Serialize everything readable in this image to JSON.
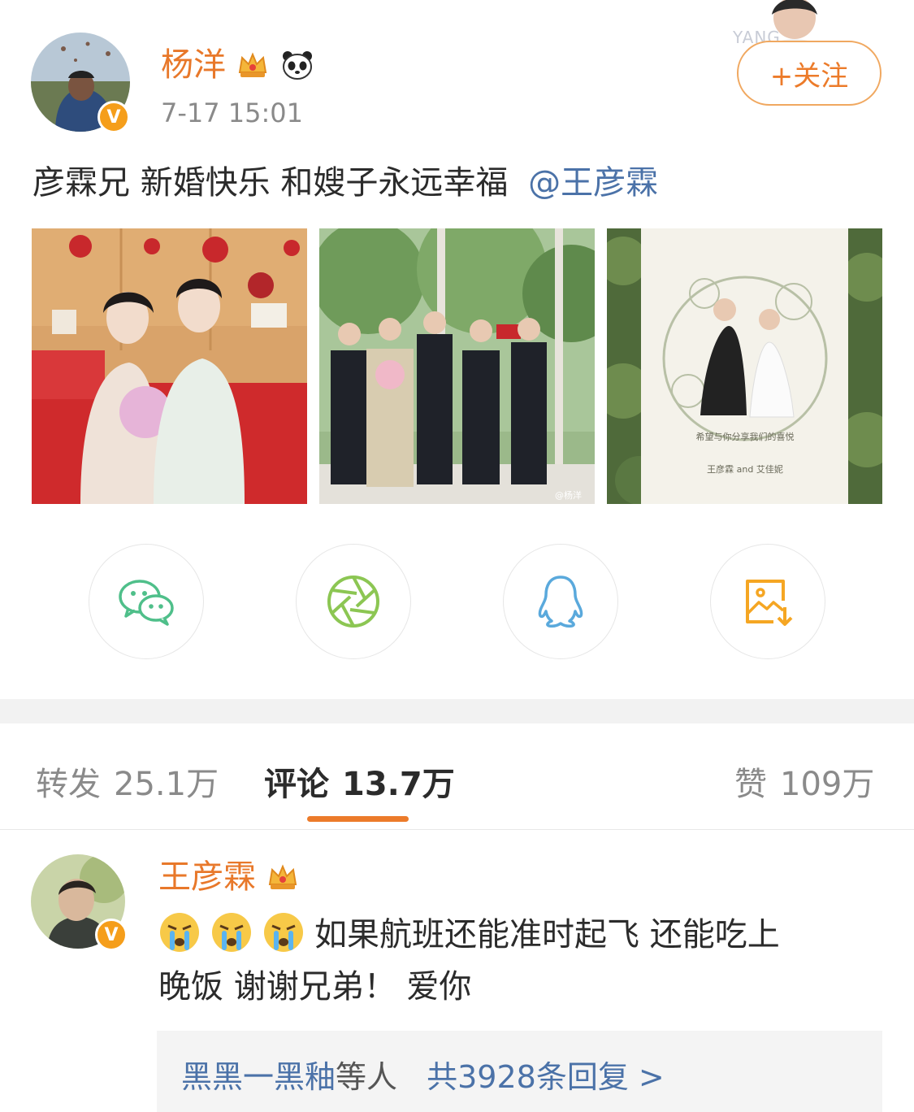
{
  "post": {
    "author": "杨洋",
    "author_badges": [
      "crown-icon",
      "panda-icon"
    ],
    "timestamp": "7-17 15:01",
    "text": "彦霖兄 新婚快乐 和嫂子永远幸福",
    "mention": "@王彦霖",
    "follow_label": "+关注",
    "corner_avatar_text": "YANG",
    "photos": [
      {
        "name": "wedding-couple-photo"
      },
      {
        "name": "groomsmen-photo",
        "watermark": "@杨洋"
      },
      {
        "name": "wedding-invitation-photo",
        "caption": "希望与你分享我们的喜悦",
        "names": "王彦霖 and 艾佳妮"
      }
    ]
  },
  "share": {
    "buttons": [
      {
        "name": "wechat-share-button",
        "icon": "wechat-icon",
        "color": "#4fbf8a"
      },
      {
        "name": "moments-share-button",
        "icon": "aperture-icon",
        "color": "#8cc653"
      },
      {
        "name": "qq-share-button",
        "icon": "qq-penguin-icon",
        "color": "#5aa9dc"
      },
      {
        "name": "save-image-button",
        "icon": "save-image-icon",
        "color": "#f5a623"
      }
    ]
  },
  "tabs": {
    "repost": {
      "label": "转发",
      "count": "25.1万"
    },
    "comment": {
      "label": "评论",
      "count": "13.7万"
    },
    "like": {
      "label": "赞",
      "count": "109万"
    }
  },
  "comment": {
    "author": "王彦霖",
    "text_line1": "如果航班还能准时起飞 还能吃上",
    "text_line2": "晚饭 谢谢兄弟！ 爱你",
    "emojis": [
      "crying-emoji",
      "crying-emoji",
      "crying-emoji"
    ],
    "replies": {
      "users": "黑黑一黑釉",
      "etc": "等人",
      "count_text": "共3928条回复 >"
    }
  },
  "colors": {
    "accent": "#ec7b2a",
    "link": "#4b72a8",
    "verified": "#f59e1b"
  }
}
